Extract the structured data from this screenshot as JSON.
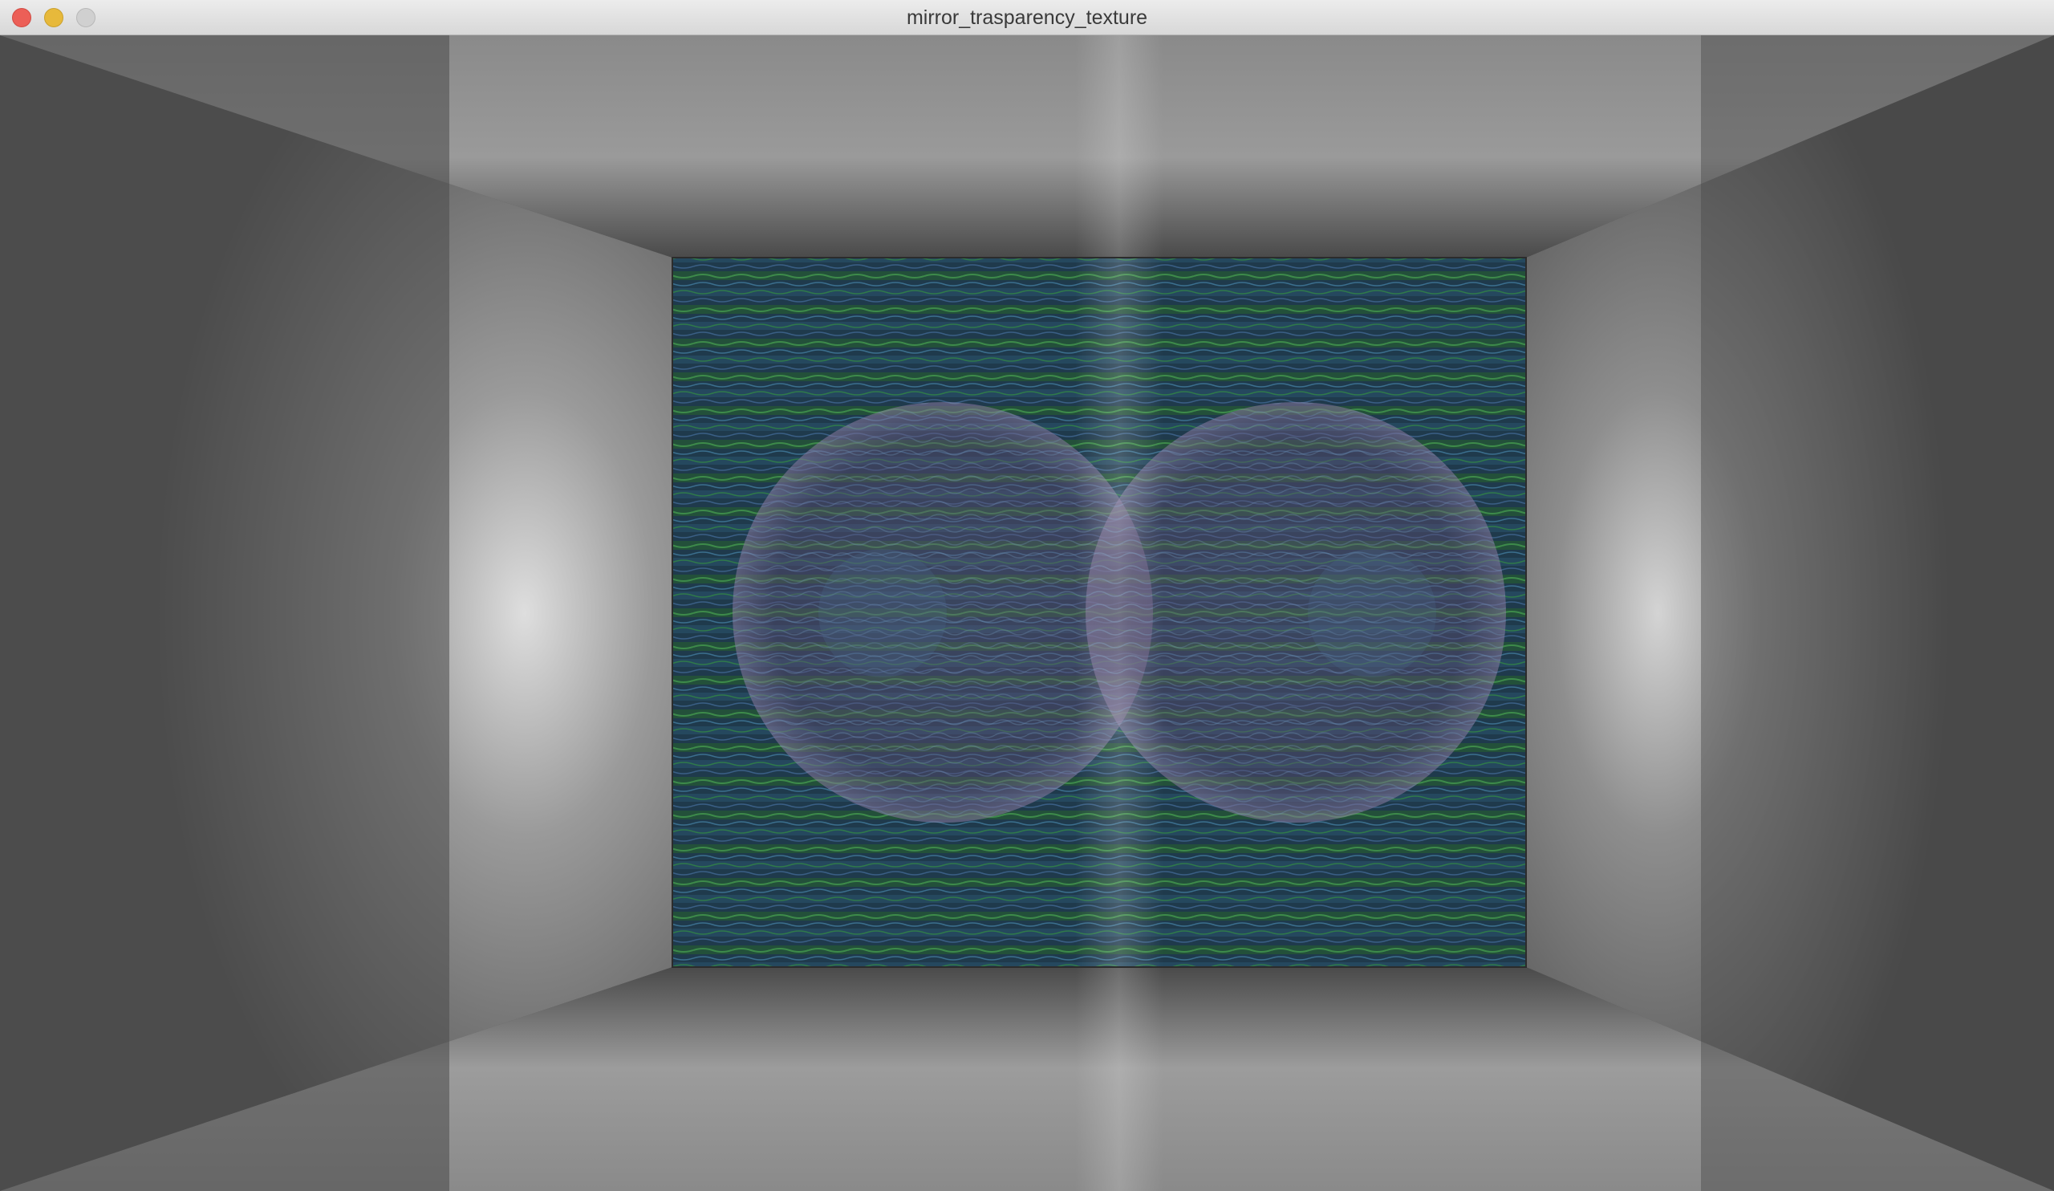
{
  "window": {
    "title": "mirror_trasparency_texture"
  },
  "controls": {
    "close_icon": "close-icon",
    "minimize_icon": "minimize-icon",
    "zoom_icon": "zoom-icon"
  },
  "colors": {
    "close": "#ec5f57",
    "minimize": "#e7b93b",
    "zoom_disabled": "#d0d0d0",
    "wall_gray": "#6e6e6e",
    "texture_green": "#2d6b35",
    "texture_blue": "#2a4a6a",
    "sphere_purple": "#5a4a6e"
  }
}
